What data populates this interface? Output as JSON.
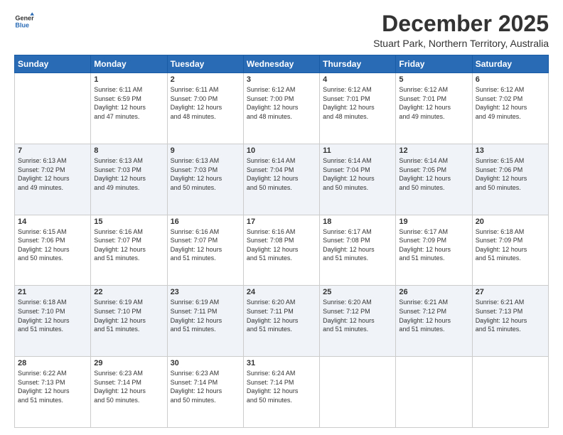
{
  "header": {
    "logo_line1": "General",
    "logo_line2": "Blue",
    "title": "December 2025",
    "subtitle": "Stuart Park, Northern Territory, Australia"
  },
  "weekdays": [
    "Sunday",
    "Monday",
    "Tuesday",
    "Wednesday",
    "Thursday",
    "Friday",
    "Saturday"
  ],
  "weeks": [
    [
      {
        "day": "",
        "info": ""
      },
      {
        "day": "1",
        "info": "Sunrise: 6:11 AM\nSunset: 6:59 PM\nDaylight: 12 hours\nand 47 minutes."
      },
      {
        "day": "2",
        "info": "Sunrise: 6:11 AM\nSunset: 7:00 PM\nDaylight: 12 hours\nand 48 minutes."
      },
      {
        "day": "3",
        "info": "Sunrise: 6:12 AM\nSunset: 7:00 PM\nDaylight: 12 hours\nand 48 minutes."
      },
      {
        "day": "4",
        "info": "Sunrise: 6:12 AM\nSunset: 7:01 PM\nDaylight: 12 hours\nand 48 minutes."
      },
      {
        "day": "5",
        "info": "Sunrise: 6:12 AM\nSunset: 7:01 PM\nDaylight: 12 hours\nand 49 minutes."
      },
      {
        "day": "6",
        "info": "Sunrise: 6:12 AM\nSunset: 7:02 PM\nDaylight: 12 hours\nand 49 minutes."
      }
    ],
    [
      {
        "day": "7",
        "info": "Sunrise: 6:13 AM\nSunset: 7:02 PM\nDaylight: 12 hours\nand 49 minutes."
      },
      {
        "day": "8",
        "info": "Sunrise: 6:13 AM\nSunset: 7:03 PM\nDaylight: 12 hours\nand 49 minutes."
      },
      {
        "day": "9",
        "info": "Sunrise: 6:13 AM\nSunset: 7:03 PM\nDaylight: 12 hours\nand 50 minutes."
      },
      {
        "day": "10",
        "info": "Sunrise: 6:14 AM\nSunset: 7:04 PM\nDaylight: 12 hours\nand 50 minutes."
      },
      {
        "day": "11",
        "info": "Sunrise: 6:14 AM\nSunset: 7:04 PM\nDaylight: 12 hours\nand 50 minutes."
      },
      {
        "day": "12",
        "info": "Sunrise: 6:14 AM\nSunset: 7:05 PM\nDaylight: 12 hours\nand 50 minutes."
      },
      {
        "day": "13",
        "info": "Sunrise: 6:15 AM\nSunset: 7:06 PM\nDaylight: 12 hours\nand 50 minutes."
      }
    ],
    [
      {
        "day": "14",
        "info": "Sunrise: 6:15 AM\nSunset: 7:06 PM\nDaylight: 12 hours\nand 50 minutes."
      },
      {
        "day": "15",
        "info": "Sunrise: 6:16 AM\nSunset: 7:07 PM\nDaylight: 12 hours\nand 51 minutes."
      },
      {
        "day": "16",
        "info": "Sunrise: 6:16 AM\nSunset: 7:07 PM\nDaylight: 12 hours\nand 51 minutes."
      },
      {
        "day": "17",
        "info": "Sunrise: 6:16 AM\nSunset: 7:08 PM\nDaylight: 12 hours\nand 51 minutes."
      },
      {
        "day": "18",
        "info": "Sunrise: 6:17 AM\nSunset: 7:08 PM\nDaylight: 12 hours\nand 51 minutes."
      },
      {
        "day": "19",
        "info": "Sunrise: 6:17 AM\nSunset: 7:09 PM\nDaylight: 12 hours\nand 51 minutes."
      },
      {
        "day": "20",
        "info": "Sunrise: 6:18 AM\nSunset: 7:09 PM\nDaylight: 12 hours\nand 51 minutes."
      }
    ],
    [
      {
        "day": "21",
        "info": "Sunrise: 6:18 AM\nSunset: 7:10 PM\nDaylight: 12 hours\nand 51 minutes."
      },
      {
        "day": "22",
        "info": "Sunrise: 6:19 AM\nSunset: 7:10 PM\nDaylight: 12 hours\nand 51 minutes."
      },
      {
        "day": "23",
        "info": "Sunrise: 6:19 AM\nSunset: 7:11 PM\nDaylight: 12 hours\nand 51 minutes."
      },
      {
        "day": "24",
        "info": "Sunrise: 6:20 AM\nSunset: 7:11 PM\nDaylight: 12 hours\nand 51 minutes."
      },
      {
        "day": "25",
        "info": "Sunrise: 6:20 AM\nSunset: 7:12 PM\nDaylight: 12 hours\nand 51 minutes."
      },
      {
        "day": "26",
        "info": "Sunrise: 6:21 AM\nSunset: 7:12 PM\nDaylight: 12 hours\nand 51 minutes."
      },
      {
        "day": "27",
        "info": "Sunrise: 6:21 AM\nSunset: 7:13 PM\nDaylight: 12 hours\nand 51 minutes."
      }
    ],
    [
      {
        "day": "28",
        "info": "Sunrise: 6:22 AM\nSunset: 7:13 PM\nDaylight: 12 hours\nand 51 minutes."
      },
      {
        "day": "29",
        "info": "Sunrise: 6:23 AM\nSunset: 7:14 PM\nDaylight: 12 hours\nand 50 minutes."
      },
      {
        "day": "30",
        "info": "Sunrise: 6:23 AM\nSunset: 7:14 PM\nDaylight: 12 hours\nand 50 minutes."
      },
      {
        "day": "31",
        "info": "Sunrise: 6:24 AM\nSunset: 7:14 PM\nDaylight: 12 hours\nand 50 minutes."
      },
      {
        "day": "",
        "info": ""
      },
      {
        "day": "",
        "info": ""
      },
      {
        "day": "",
        "info": ""
      }
    ]
  ]
}
